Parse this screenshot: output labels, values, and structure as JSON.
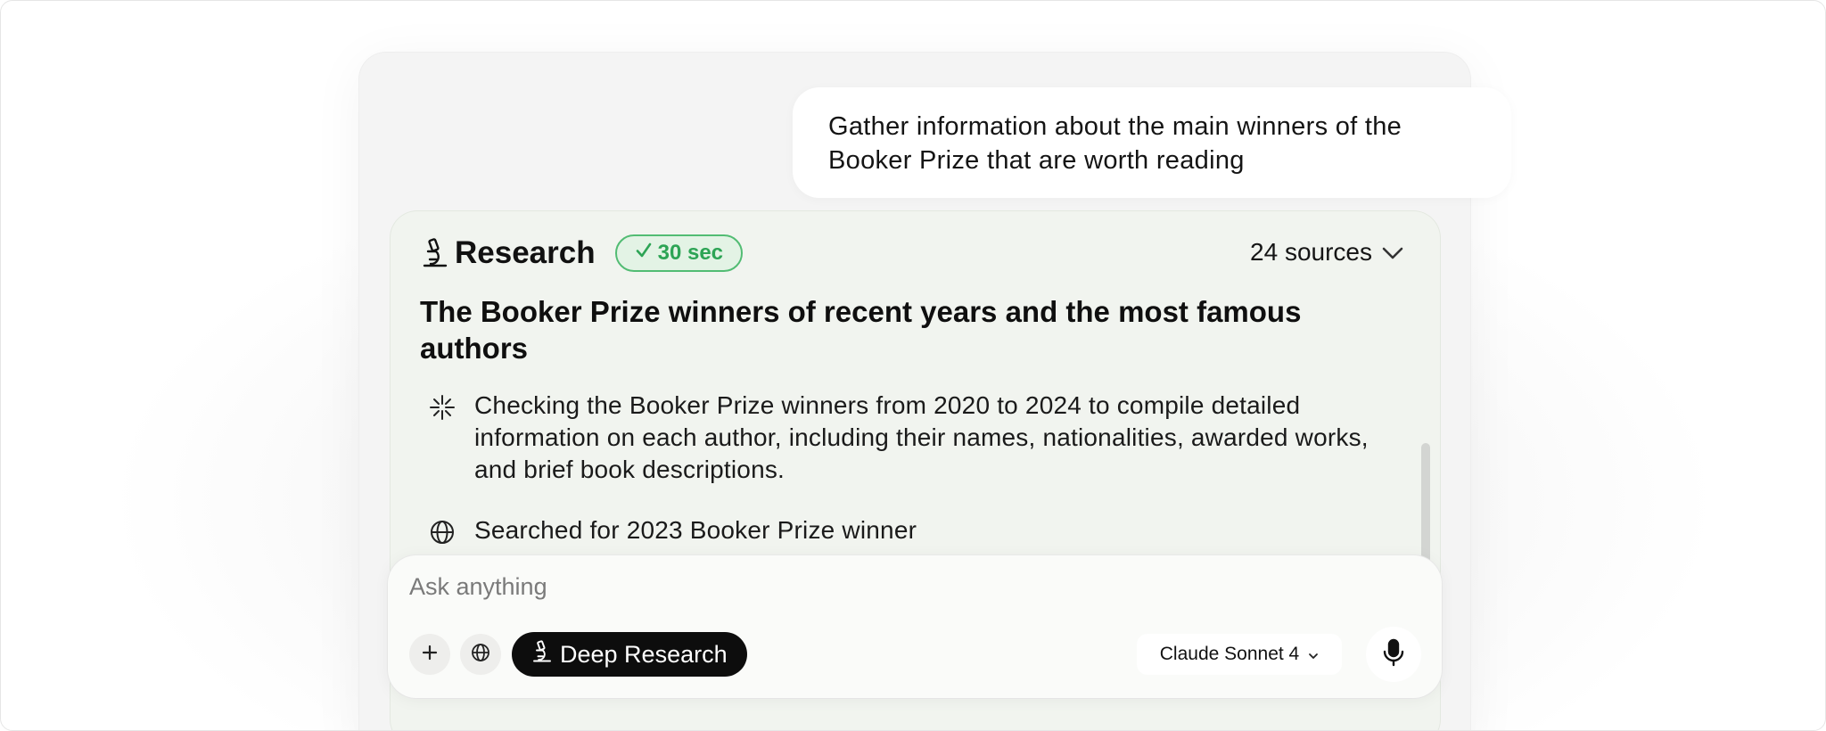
{
  "chat": {
    "user_message": "Gather information about the main winners of the Booker Prize that are worth reading"
  },
  "research": {
    "icon": "microscope-icon",
    "title": "Research",
    "time_badge": "30 sec",
    "sources_label": "24 sources",
    "heading": "The Booker Prize winners of recent years and the most famous authors",
    "steps": [
      {
        "icon": "sparkle-icon",
        "text": "Checking the Booker Prize winners from 2020 to 2024 to compile detailed information on each author, including their names, nationalities, awarded works, and brief book descriptions."
      },
      {
        "icon": "globe-icon",
        "text": "Searched for 2023 Booker Prize winner"
      }
    ]
  },
  "composer": {
    "placeholder": "Ask anything",
    "deep_research_label": "Deep Research",
    "model_label": "Claude Sonnet 4"
  },
  "colors": {
    "accent_green": "#2da455",
    "badge_bg": "#e3f3e5",
    "card_bg": "#f1f4ef",
    "button_dark": "#0d0d0d"
  }
}
